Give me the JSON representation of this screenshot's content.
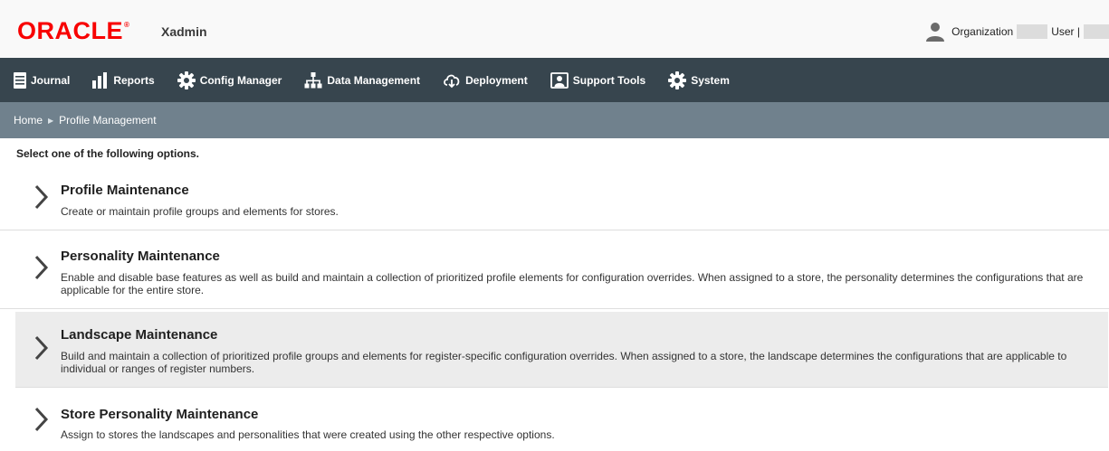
{
  "header": {
    "logo_text": "ORACLE",
    "logo_mark": "®",
    "app_name": "Xadmin",
    "organization_label": "Organization",
    "user_label": "User |",
    "user_icon": "user-icon",
    "brand_color": "#f80000"
  },
  "nav": {
    "items": [
      {
        "label": "Journal",
        "icon": "journal-icon"
      },
      {
        "label": "Reports",
        "icon": "bar-chart-icon"
      },
      {
        "label": "Config Manager",
        "icon": "gear-icon"
      },
      {
        "label": "Data Management",
        "icon": "hierarchy-icon"
      },
      {
        "label": "Deployment",
        "icon": "cloud-download-icon"
      },
      {
        "label": "Support Tools",
        "icon": "support-icon"
      },
      {
        "label": "System",
        "icon": "gear-icon"
      }
    ],
    "background": "#37454e"
  },
  "breadcrumb": {
    "home": "Home",
    "separator": "▶",
    "current": "Profile Management"
  },
  "main": {
    "intro": "Select one of the following options.",
    "options": [
      {
        "title": "Profile Maintenance",
        "description": "Create or maintain profile groups and elements for stores."
      },
      {
        "title": "Personality Maintenance",
        "description": "Enable and disable base features as well as build and maintain a collection of prioritized profile elements for configuration overrides. When assigned to a store, the personality determines the configurations that are applicable for the entire store."
      },
      {
        "title": "Landscape Maintenance",
        "description": "Build and maintain a collection of prioritized profile groups and elements for register-specific configuration overrides. When assigned to a store, the landscape determines the configurations that are applicable to individual or ranges of register numbers."
      },
      {
        "title": "Store Personality Maintenance",
        "description": "Assign to stores the landscapes and personalities that were created using the other respective options."
      }
    ]
  }
}
